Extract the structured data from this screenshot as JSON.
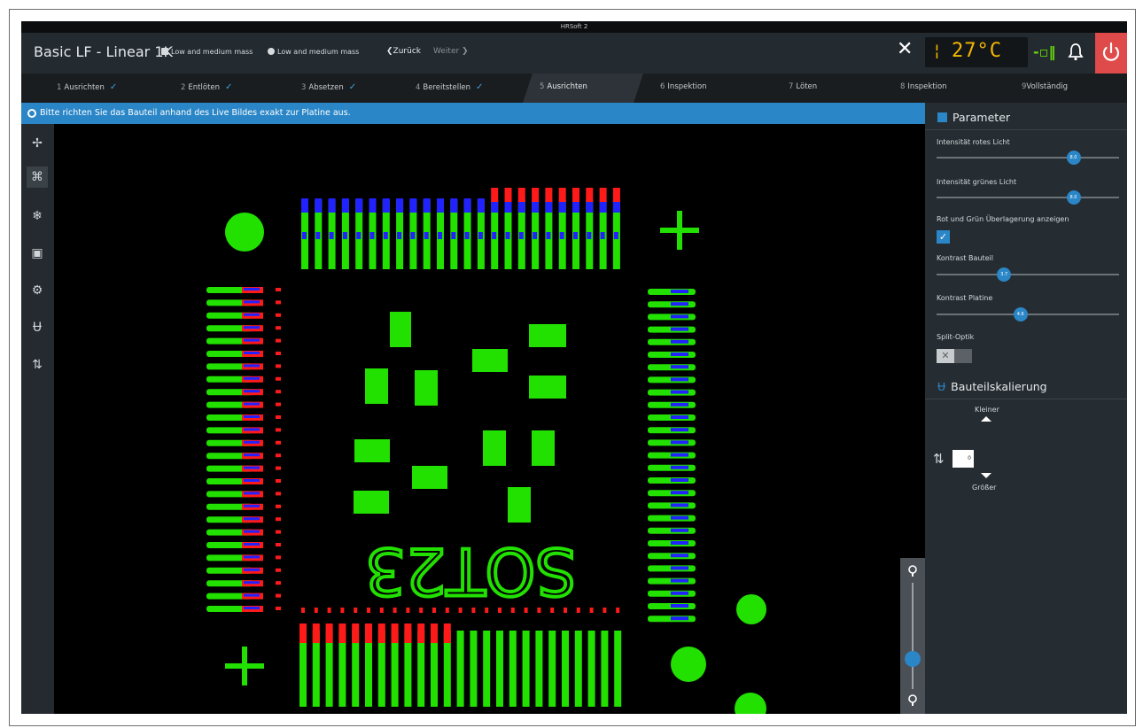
{
  "window": {
    "title": "HRSoft 2"
  },
  "header": {
    "title": "Basic LF - Linear 1K",
    "mass_a": "Low and medium mass",
    "mass_b": "Low and medium mass",
    "back_label": "❮Zurück",
    "next_label": "Weiter ❯",
    "temperature": "27°C",
    "close_icon": "close-icon",
    "connection_icon": "plug-icon",
    "bell_icon": "bell-icon",
    "power_icon": "power-icon"
  },
  "steps": [
    {
      "num": "1",
      "label": "Ausrichten",
      "done": true
    },
    {
      "num": "2",
      "label": "Entlöten",
      "done": true
    },
    {
      "num": "3",
      "label": "Absetzen",
      "done": true
    },
    {
      "num": "4",
      "label": "Bereitstellen",
      "done": true
    },
    {
      "num": "5",
      "label": "Ausrichten",
      "active": true
    },
    {
      "num": "6",
      "label": "Inspektion"
    },
    {
      "num": "7",
      "label": "Löten"
    },
    {
      "num": "8",
      "label": "Inspektion"
    },
    {
      "num": "9",
      "label": "Vollständig"
    }
  ],
  "info": {
    "message": "Bitte richten Sie das Bauteil anhand des Live Bildes exakt zur Platine aus."
  },
  "toolbar": [
    "crosshair-icon",
    "component-icon",
    "snowflake-icon",
    "image-icon",
    "gear-icon",
    "nozzle-icon",
    "swap-vertical-icon"
  ],
  "image": {
    "marking": "SOT23"
  },
  "zoom": {
    "level": 0.28
  },
  "panel": {
    "parameter_title": "Parameter",
    "sliders": [
      {
        "label": "Intensität rotes Licht",
        "value": "8.0",
        "fraction": 0.75
      },
      {
        "label": "Intensität grünes Licht",
        "value": "8.0",
        "fraction": 0.75
      },
      {
        "label": "Kontrast Bauteil",
        "value": "3.7",
        "fraction": 0.37
      },
      {
        "label": "Kontrast Platine",
        "value": "4.6",
        "fraction": 0.46
      }
    ],
    "overlay_label": "Rot und Grün Überlagerung anzeigen",
    "overlay_checked": true,
    "split_label": "Split-Optik",
    "scaling_title": "Bauteilskalierung",
    "smaller_label": "Kleiner",
    "larger_label": "Größer",
    "scale_value": "0"
  },
  "colors": {
    "accent": "#2a86c7",
    "power": "#df4b4a",
    "temp": "#f5b700",
    "pcb_green": "#22e000",
    "pad_red": "#ff1a1a",
    "pad_blue": "#2222ff"
  }
}
